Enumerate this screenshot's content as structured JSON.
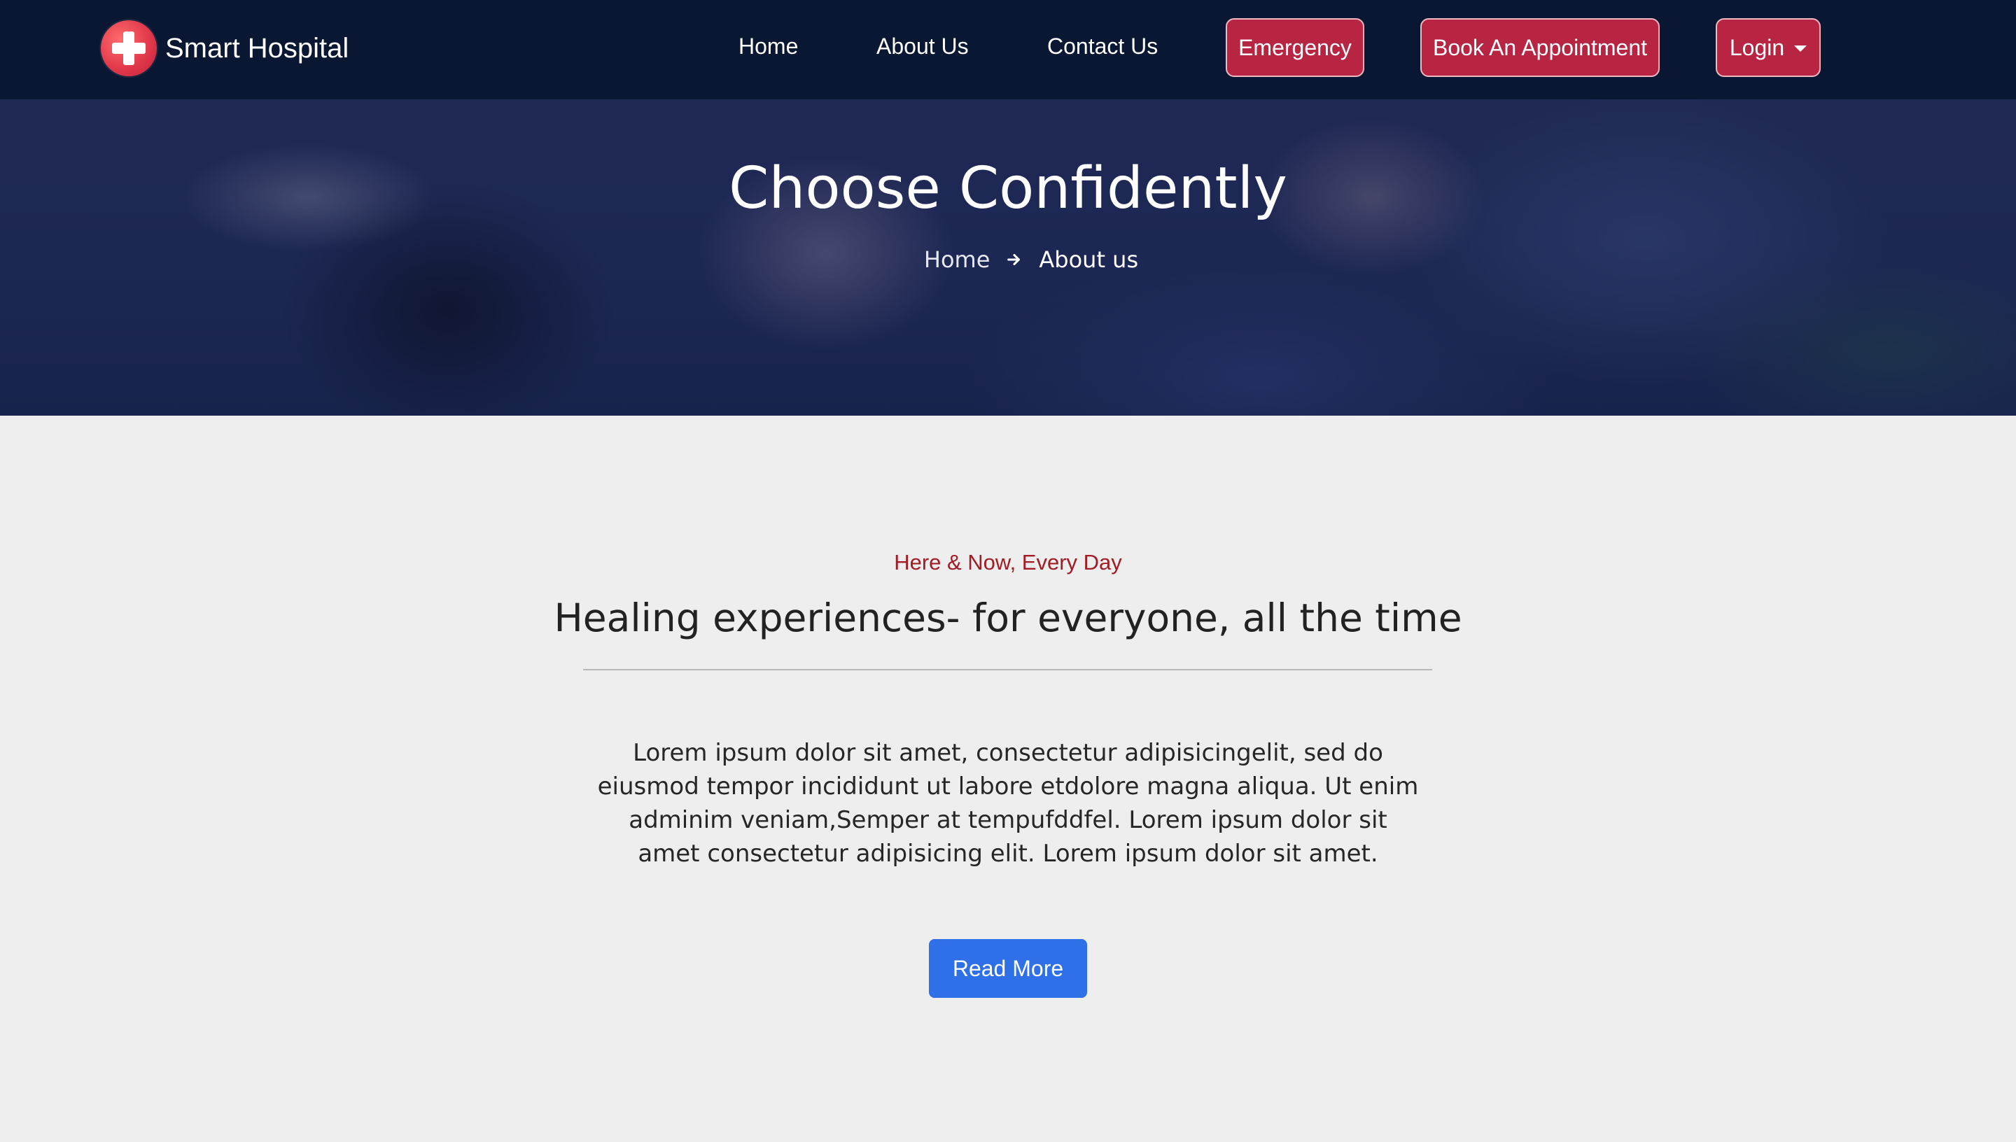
{
  "navbar": {
    "brand_name": "Smart Hospital",
    "links": {
      "home": "Home",
      "about": "About Us",
      "contact": "Contact Us"
    },
    "buttons": {
      "emergency": "Emergency",
      "appointment": "Book An Appointment",
      "login": "Login"
    },
    "colors": {
      "background": "#0a1733",
      "button": "#b82543"
    }
  },
  "hero": {
    "title": "Choose Confidently",
    "breadcrumb": {
      "home": "Home",
      "current": "About us"
    }
  },
  "main": {
    "tagline": "Here & Now, Every Day",
    "title": "Healing experiences- for everyone, all the time",
    "body": "Lorem ipsum dolor sit amet, consectetur adipisicingelit, sed do eiusmod tempor incididunt ut labore etdolore magna aliqua. Ut enim adminim veniam,Semper at tempufddfel. Lorem ipsum dolor sit amet consectetur adipisicing elit. Lorem ipsum dolor sit amet.",
    "read_more": "Read More",
    "colors": {
      "tagline": "#a11c24",
      "read_more_button": "#2f6fe8"
    }
  },
  "icons": {
    "logo": "hospital-cross-icon",
    "breadcrumb_separator": "arrow-right-icon",
    "login_dropdown": "caret-down-icon"
  }
}
